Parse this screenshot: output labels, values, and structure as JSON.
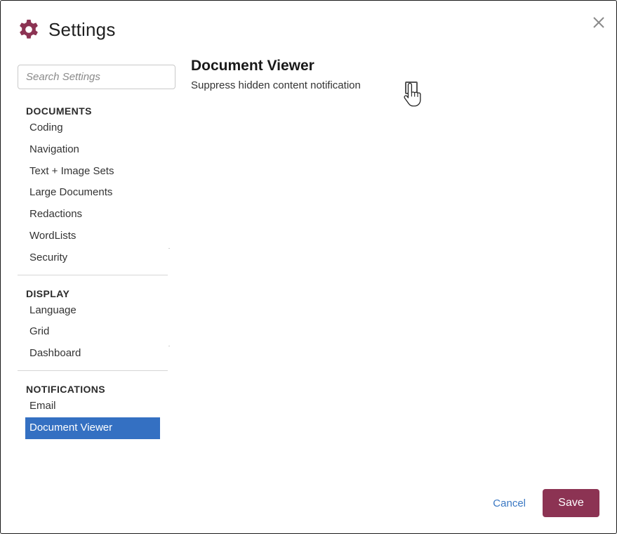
{
  "dialog": {
    "title": "Settings",
    "icon": "gear-icon",
    "close_icon": "close-icon",
    "accent_color": "#8c3353",
    "selection_color": "#3470c2"
  },
  "sidebar": {
    "search": {
      "placeholder": "Search Settings",
      "value": ""
    },
    "sections": [
      {
        "heading": "DOCUMENTS",
        "items": [
          {
            "label": "Coding"
          },
          {
            "label": "Navigation"
          },
          {
            "label": "Text + Image Sets"
          },
          {
            "label": "Large Documents"
          },
          {
            "label": "Redactions"
          },
          {
            "label": "WordLists"
          },
          {
            "label": "Security"
          }
        ]
      },
      {
        "heading": "DISPLAY",
        "items": [
          {
            "label": "Language"
          },
          {
            "label": "Grid"
          },
          {
            "label": "Dashboard"
          }
        ]
      },
      {
        "heading": "NOTIFICATIONS",
        "items": [
          {
            "label": "Email"
          },
          {
            "label": "Document Viewer",
            "selected": true
          }
        ]
      }
    ]
  },
  "content": {
    "title": "Document Viewer",
    "settings": [
      {
        "label": "Suppress hidden content notification",
        "checked": false
      }
    ]
  },
  "footer": {
    "cancel_label": "Cancel",
    "save_label": "Save"
  },
  "cursor": "hand-pointer-icon"
}
